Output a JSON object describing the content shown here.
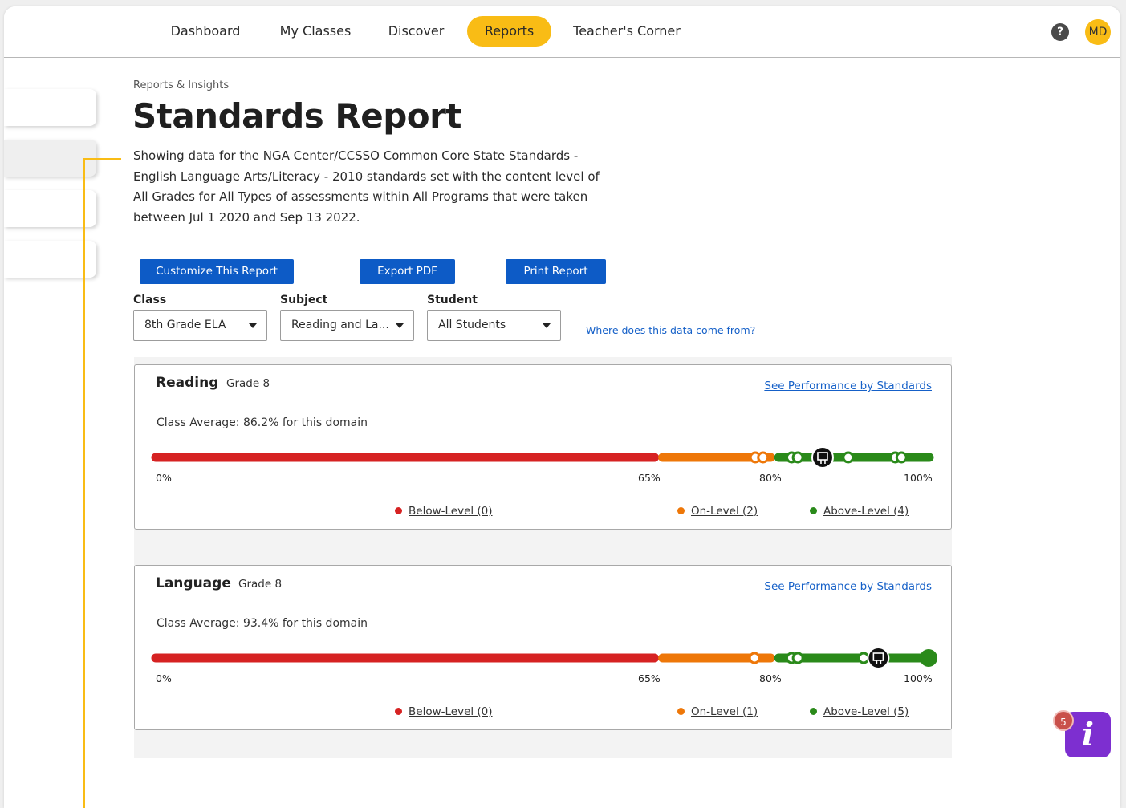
{
  "nav": {
    "items": [
      "Dashboard",
      "My Classes",
      "Discover",
      "Reports",
      "Teacher's Corner"
    ],
    "active": "Reports",
    "help_symbol": "?",
    "avatar_initials": "MD"
  },
  "breadcrumb": "Reports & Insights",
  "title": "Standards Report",
  "description": "Showing data for the NGA Center/CCSSO Common Core State Standards - English Language Arts/Literacy - 2010 standards set with the content level of All Grades for All Types of assessments within All Programs that were taken between Jul 1 2020 and Sep 13 2022.",
  "buttons": {
    "customize": "Customize This Report",
    "export": "Export PDF",
    "print": "Print Report"
  },
  "filters": {
    "class_label": "Class",
    "class_value": "8th Grade ELA",
    "subject_label": "Subject",
    "subject_value": "Reading and La...",
    "student_label": "Student",
    "student_value": "All Students"
  },
  "data_source_link": "Where does this data come from?",
  "colors": {
    "below": "#d62222",
    "on": "#ee7708",
    "above": "#2a8a1a",
    "primary_button": "#0d5bc6",
    "accent": "#f9bc15"
  },
  "ticks": [
    "0%",
    "65%",
    "80%",
    "100%"
  ],
  "domains": [
    {
      "name": "Reading",
      "grade": "Grade 8",
      "link": "See Performance by Standards",
      "average_text": "Class Average: 86.2% for this domain",
      "class_average": 86.2,
      "students": [
        {
          "level": "on",
          "score": 77.5
        },
        {
          "level": "on",
          "score": 78.5
        },
        {
          "level": "above",
          "score": 82.2
        },
        {
          "level": "above",
          "score": 83.0
        },
        {
          "level": "above",
          "score": 89.5
        },
        {
          "level": "above",
          "score": 95.6
        },
        {
          "level": "above",
          "score": 96.4
        }
      ],
      "legend": {
        "below": "Below-Level (0)",
        "on": "On-Level (2)",
        "above": "Above-Level (4)"
      }
    },
    {
      "name": "Language",
      "grade": "Grade 8",
      "link": "See Performance by Standards",
      "average_text": "Class Average: 93.4% for this domain",
      "class_average": 93.4,
      "students": [
        {
          "level": "on",
          "score": 77.4
        },
        {
          "level": "above",
          "score": 82.2
        },
        {
          "level": "above",
          "score": 83.0
        },
        {
          "level": "above",
          "score": 91.5
        },
        {
          "level": "above",
          "score": 99.9
        }
      ],
      "legend": {
        "below": "Below-Level (0)",
        "on": "On-Level (1)",
        "above": "Above-Level (5)"
      }
    }
  ],
  "help_widget": {
    "badge_count": "5",
    "icon_letter": "i"
  }
}
